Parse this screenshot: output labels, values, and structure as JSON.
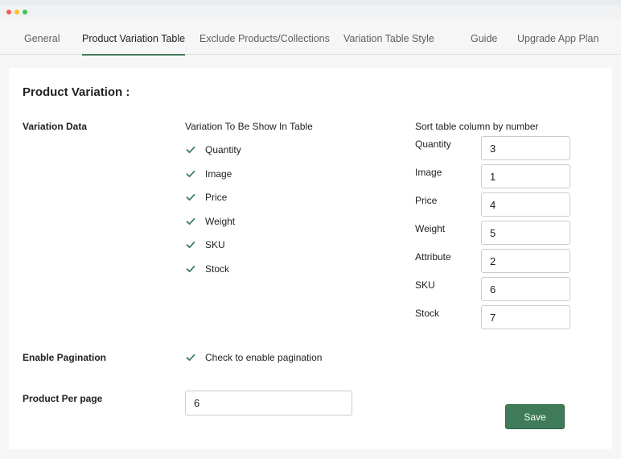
{
  "window": {
    "controls": [
      {
        "name": "close",
        "color": "#f25f58"
      },
      {
        "name": "minimize",
        "color": "#fbbe2e"
      },
      {
        "name": "maximize",
        "color": "#38c84a"
      }
    ]
  },
  "tabs": [
    {
      "label": "General",
      "active": false
    },
    {
      "label": "Product Variation Table",
      "active": true
    },
    {
      "label": "Exclude Products/Collections",
      "active": false
    },
    {
      "label": "Variation Table Style",
      "active": false
    },
    {
      "label": "Guide",
      "active": false
    },
    {
      "label": "Upgrade App Plan",
      "active": false
    }
  ],
  "section_title": "Product Variation :",
  "variation_data": {
    "label": "Variation Data",
    "show_heading": "Variation To Be Show In Table",
    "show_items": [
      {
        "label": "Quantity",
        "checked": true
      },
      {
        "label": "Image",
        "checked": true
      },
      {
        "label": "Price",
        "checked": true
      },
      {
        "label": "Weight",
        "checked": true
      },
      {
        "label": "SKU",
        "checked": true
      },
      {
        "label": "Stock",
        "checked": true
      }
    ],
    "sort_heading": "Sort table column by number",
    "sort_items": [
      {
        "label": "Quantity",
        "value": "3"
      },
      {
        "label": "Image",
        "value": "1"
      },
      {
        "label": "Price",
        "value": "4"
      },
      {
        "label": "Weight",
        "value": "5"
      },
      {
        "label": "Attribute",
        "value": "2"
      },
      {
        "label": "SKU",
        "value": "6"
      },
      {
        "label": "Stock",
        "value": "7"
      }
    ]
  },
  "pagination": {
    "label": "Enable Pagination",
    "checkbox_label": "Check to enable pagination",
    "checked": true
  },
  "per_page": {
    "label": "Product Per page",
    "value": "6"
  },
  "save_label": "Save",
  "colors": {
    "accent": "#3f7b58",
    "checkmark": "#3f7b58"
  }
}
